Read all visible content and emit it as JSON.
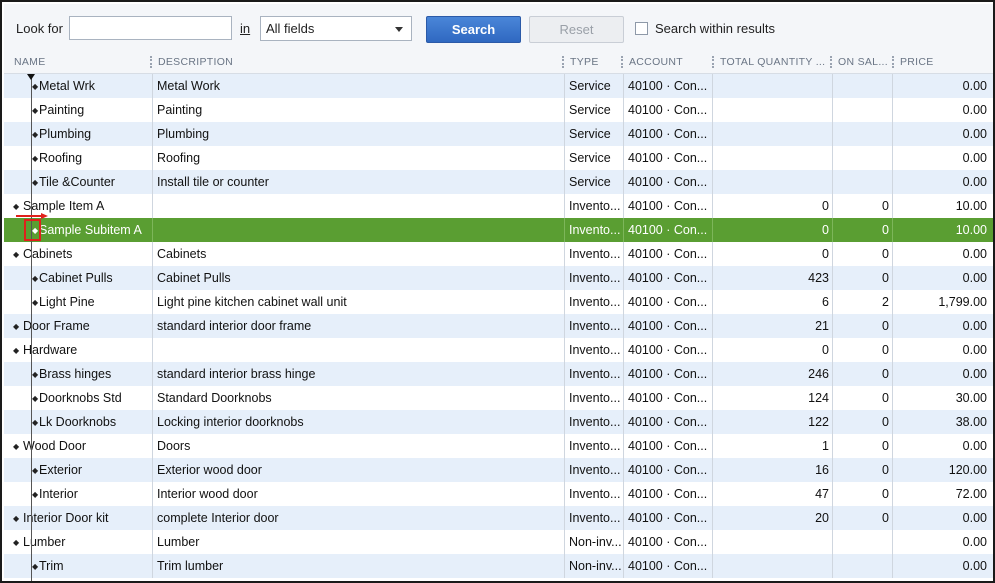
{
  "search": {
    "look_for_label": "Look for",
    "look_for_value": "",
    "in_label": "in",
    "field_select": "All fields",
    "search_button": "Search",
    "reset_button": "Reset",
    "within_label": "Search within results",
    "within_checked": false
  },
  "columns": {
    "name": "NAME",
    "description": "DESCRIPTION",
    "type": "TYPE",
    "account": "ACCOUNT",
    "total_quantity": "TOTAL QUANTITY ...",
    "on_sales": "ON SAL...",
    "price": "PRICE"
  },
  "rows": [
    {
      "name": "Metal Wrk",
      "level": 1,
      "description": "Metal Work",
      "type": "Service",
      "account": "40100 · Con...",
      "qty": "",
      "on_sales": "",
      "price": "0.00"
    },
    {
      "name": "Painting",
      "level": 1,
      "description": "Painting",
      "type": "Service",
      "account": "40100 · Con...",
      "qty": "",
      "on_sales": "",
      "price": "0.00"
    },
    {
      "name": "Plumbing",
      "level": 1,
      "description": "Plumbing",
      "type": "Service",
      "account": "40100 · Con...",
      "qty": "",
      "on_sales": "",
      "price": "0.00"
    },
    {
      "name": "Roofing",
      "level": 1,
      "description": "Roofing",
      "type": "Service",
      "account": "40100 · Con...",
      "qty": "",
      "on_sales": "",
      "price": "0.00"
    },
    {
      "name": "Tile &Counter",
      "level": 1,
      "description": "Install tile or counter",
      "type": "Service",
      "account": "40100 · Con...",
      "qty": "",
      "on_sales": "",
      "price": "0.00"
    },
    {
      "name": "Sample Item A",
      "level": 0,
      "description": "",
      "type": "Invento...",
      "account": "40100 · Con...",
      "qty": "0",
      "on_sales": "0",
      "price": "10.00"
    },
    {
      "name": "Sample Subitem A",
      "level": 1,
      "description": "",
      "type": "Invento...",
      "account": "40100 · Con...",
      "qty": "0",
      "on_sales": "0",
      "price": "10.00",
      "selected": true
    },
    {
      "name": "Cabinets",
      "level": 0,
      "description": "Cabinets",
      "type": "Invento...",
      "account": "40100 · Con...",
      "qty": "0",
      "on_sales": "0",
      "price": "0.00"
    },
    {
      "name": "Cabinet Pulls",
      "level": 1,
      "description": "Cabinet Pulls",
      "type": "Invento...",
      "account": "40100 · Con...",
      "qty": "423",
      "on_sales": "0",
      "price": "0.00"
    },
    {
      "name": "Light Pine",
      "level": 1,
      "description": "Light pine kitchen cabinet wall unit",
      "type": "Invento...",
      "account": "40100 · Con...",
      "qty": "6",
      "on_sales": "2",
      "price": "1,799.00"
    },
    {
      "name": "Door Frame",
      "level": 0,
      "description": "standard interior door frame",
      "type": "Invento...",
      "account": "40100 · Con...",
      "qty": "21",
      "on_sales": "0",
      "price": "0.00"
    },
    {
      "name": "Hardware",
      "level": 0,
      "description": "",
      "type": "Invento...",
      "account": "40100 · Con...",
      "qty": "0",
      "on_sales": "0",
      "price": "0.00"
    },
    {
      "name": "Brass hinges",
      "level": 1,
      "description": "standard interior brass hinge",
      "type": "Invento...",
      "account": "40100 · Con...",
      "qty": "246",
      "on_sales": "0",
      "price": "0.00"
    },
    {
      "name": "Doorknobs Std",
      "level": 1,
      "description": "Standard Doorknobs",
      "type": "Invento...",
      "account": "40100 · Con...",
      "qty": "124",
      "on_sales": "0",
      "price": "30.00"
    },
    {
      "name": "Lk Doorknobs",
      "level": 1,
      "description": "Locking interior doorknobs",
      "type": "Invento...",
      "account": "40100 · Con...",
      "qty": "122",
      "on_sales": "0",
      "price": "38.00"
    },
    {
      "name": "Wood Door",
      "level": 0,
      "description": "Doors",
      "type": "Invento...",
      "account": "40100 · Con...",
      "qty": "1",
      "on_sales": "0",
      "price": "0.00"
    },
    {
      "name": "Exterior",
      "level": 1,
      "description": "Exterior wood door",
      "type": "Invento...",
      "account": "40100 · Con...",
      "qty": "16",
      "on_sales": "0",
      "price": "120.00"
    },
    {
      "name": "Interior",
      "level": 1,
      "description": "Interior wood door",
      "type": "Invento...",
      "account": "40100 · Con...",
      "qty": "47",
      "on_sales": "0",
      "price": "72.00"
    },
    {
      "name": "Interior Door kit",
      "level": 0,
      "description": "complete Interior door",
      "type": "Invento...",
      "account": "40100 · Con...",
      "qty": "20",
      "on_sales": "0",
      "price": "0.00"
    },
    {
      "name": "Lumber",
      "level": 0,
      "description": "Lumber",
      "type": "Non-inv...",
      "account": "40100 · Con...",
      "qty": "",
      "on_sales": "",
      "price": "0.00"
    },
    {
      "name": "Trim",
      "level": 1,
      "description": "Trim lumber",
      "type": "Non-inv...",
      "account": "40100 · Con...",
      "qty": "",
      "on_sales": "",
      "price": "0.00"
    }
  ],
  "colors": {
    "selected_row": "#5a9e32",
    "alt_row": "#e6effa",
    "search_button": "#3a78cf",
    "annotation": "#e0201b"
  },
  "icons": {
    "tree_node": "diamond-icon",
    "dropdown": "chevron-down-icon",
    "annotation_arrow": "red-arrow-icon"
  }
}
